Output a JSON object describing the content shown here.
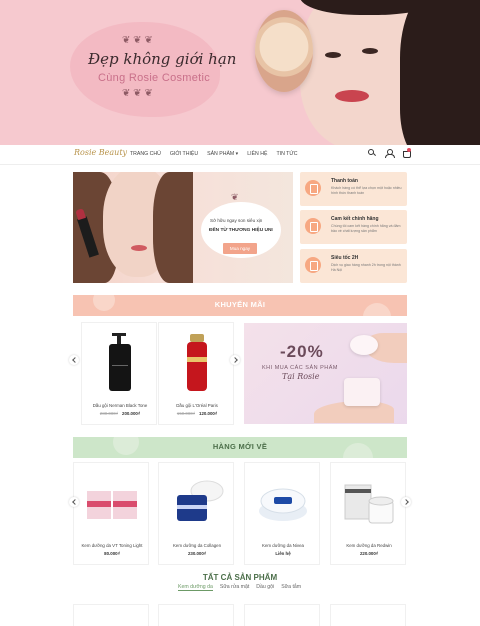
{
  "hero": {
    "script_title": "Đẹp không giới hạn",
    "brand_line": "Cùng Rosie Cosmetic"
  },
  "nav": {
    "logo": "Rosie Beauty",
    "menu": [
      "TRANG CHỦ",
      "GIỚI THIỆU",
      "SẢN PHẨM ▾",
      "LIÊN HỆ",
      "TIN TỨC"
    ]
  },
  "promo": {
    "line1": "Sở hữu ngay son siêu xịn",
    "line2": "ĐẾN TỪ THƯƠNG HIỆU UNI",
    "button": "Mua ngay"
  },
  "features": [
    {
      "title": "Thanh toán",
      "desc": "Khách hàng có thể lựa chọn một hoặc nhiều hình thức thanh toán"
    },
    {
      "title": "Cam kết chính hãng",
      "desc": "Chúng tôi cam kết hàng chính hãng và đảm bảo về chất lượng sản phẩm"
    },
    {
      "title": "Siêu tốc 2H",
      "desc": "Dịch vụ giao hàng nhanh 2h trong nội thành Hà Nội"
    }
  ],
  "sale_section": {
    "title": "KHUYẾN MÃI",
    "products": [
      {
        "name": "Dầu gội Nerman Black Tone",
        "old_price": "280.000₫",
        "price": "200.000₫"
      },
      {
        "name": "Dầu gội L'Oréal Paris",
        "old_price": "150.000₫",
        "price": "120.000₫"
      }
    ],
    "banner": {
      "percent": "-20%",
      "text": "KHI MUA CÁC SẢN PHẨM",
      "script": "Tại Rosie"
    }
  },
  "new_section": {
    "title": "HÀNG MỚI VỀ",
    "products": [
      {
        "name": "Kem dưỡng da VT Toning Light",
        "price": "80.000₫"
      },
      {
        "name": "Kem dưỡng da Collagen",
        "price": "230.000₫"
      },
      {
        "name": "Kem dưỡng da Nivea",
        "price": "Liên hệ"
      },
      {
        "name": "Kem dưỡng da Redwin",
        "price": "220.000₫"
      }
    ]
  },
  "all_section": {
    "title": "TẤT CẢ SẢN PHẨM",
    "tabs": [
      "Kem dưỡng da",
      "Sữa rửa mặt",
      "Dầu gội",
      "Sữa tắm"
    ]
  }
}
